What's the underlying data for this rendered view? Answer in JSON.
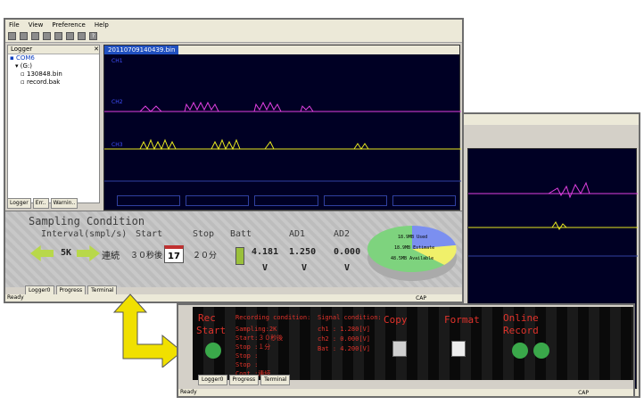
{
  "menu": {
    "items": [
      "File",
      "View",
      "Preference",
      "Help"
    ]
  },
  "logger_pane": {
    "title": "Logger",
    "tree": [
      "COM6",
      "(G:)",
      "130848.bin",
      "record.bak"
    ],
    "tabs": [
      "Logger",
      "Err..",
      "Warnin.."
    ]
  },
  "scope": {
    "tab_label": "20110709140439.bin",
    "channel_labels": [
      "CH1",
      "CH2",
      "CH3"
    ],
    "value_boxes": [
      "",
      "",
      "",
      "",
      ""
    ]
  },
  "sampling": {
    "title": "Sampling Condition",
    "interval_label": "Interval(smpl/s)",
    "interval_value": "5K",
    "mode_value": "連続",
    "start_label": "Start",
    "start_value": "３０秒後",
    "calendar_day": "17",
    "stop_label": "Stop",
    "stop_value": "２０分",
    "batt_label": "Batt",
    "batt_value": "4.181",
    "batt_unit": "V",
    "ad1_label": "AD1",
    "ad1_value": "1.250",
    "ad1_unit": "V",
    "ad2_label": "AD2",
    "ad2_value": "0.000",
    "ad2_unit": "V",
    "pie": {
      "used_text": "18.9MB Used",
      "estimate_text": "18.9MB Estimate",
      "available_text": "48.5MB Available",
      "colors": {
        "used": "#7b8ff0",
        "estimate": "#f0f06a",
        "available": "#7ed37e"
      }
    }
  },
  "bottom_tabs": [
    "Logger0",
    "Progress",
    "Terminal"
  ],
  "status": {
    "ready": "Ready",
    "cap": "CAP"
  },
  "record": {
    "rec_label": "Rec",
    "start_label": "Start",
    "recording_title": "Recording condition:",
    "recording_lines": [
      "Sampling:2K",
      "Start:３０秒後",
      "Stop :１分",
      "Stop :",
      "Stop :",
      "Cont :連続"
    ],
    "signal_title": "Signal condition:",
    "signal_lines": [
      "ch1 : 1.280[V]",
      "ch2 : 0.000[V]",
      "Bat : 4.200[V]"
    ],
    "copy_label": "Copy",
    "format_label": "Format",
    "online_label": "Online",
    "record_label": "Record"
  },
  "colors": {
    "trace1": "#e040e0",
    "trace2": "#e8e820",
    "scope_bg": "#000024",
    "accent_red": "#e0322a",
    "arrow": "#f0e000"
  }
}
